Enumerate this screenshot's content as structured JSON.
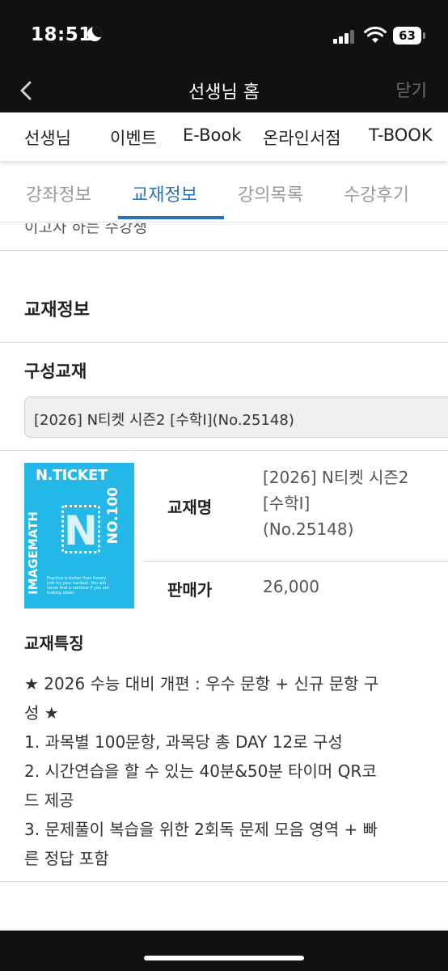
{
  "status_bar": {
    "time": "18:51",
    "battery": "63"
  },
  "header": {
    "title": "선생님 홈",
    "close_label": "닫기"
  },
  "top_menu": [
    "선생님",
    "이벤트",
    "E-Book",
    "온라인서점",
    "T-BOOK"
  ],
  "sub_tabs": {
    "items": [
      "강좌정보",
      "교재정보",
      "강의목록",
      "수강후기"
    ],
    "active": "교재정보"
  },
  "cutoff_text": "이고자 하는 수강생",
  "section": {
    "title": "교재정보",
    "composition_label": "구성교재",
    "selected_book": "[2026] N티켓 시즌2 [수학Ⅰ](No.25148)"
  },
  "book": {
    "cover": {
      "title": "N.TICKET",
      "number": "NO.100",
      "brand": "IMAGEMATH",
      "letter": "N",
      "tagline": "Practice is better than theory. Just try your hardest. You will never find a rainbow if you are looking down."
    },
    "name_label": "교재명",
    "name_lines": [
      "[2026] N티켓 시즌2",
      "[수학Ⅰ]",
      "(No.25148)"
    ],
    "price_label": "판매가",
    "price": "26,000"
  },
  "features": {
    "title": "교재특징",
    "lines": [
      "★ 2026 수능 대비 개편 : 우수 문항 + 신규 문항 구",
      "성 ★",
      "1. 과목별 100문항, 과목당 총 DAY 12로 구성",
      "2. 시간연습을 할 수 있는 40분&50분 타이머 QR코",
      "드 제공",
      "3. 문제풀이 복습을 위한 2회독 문제 모음 영역 + 빠",
      "른 정답 포함"
    ]
  }
}
